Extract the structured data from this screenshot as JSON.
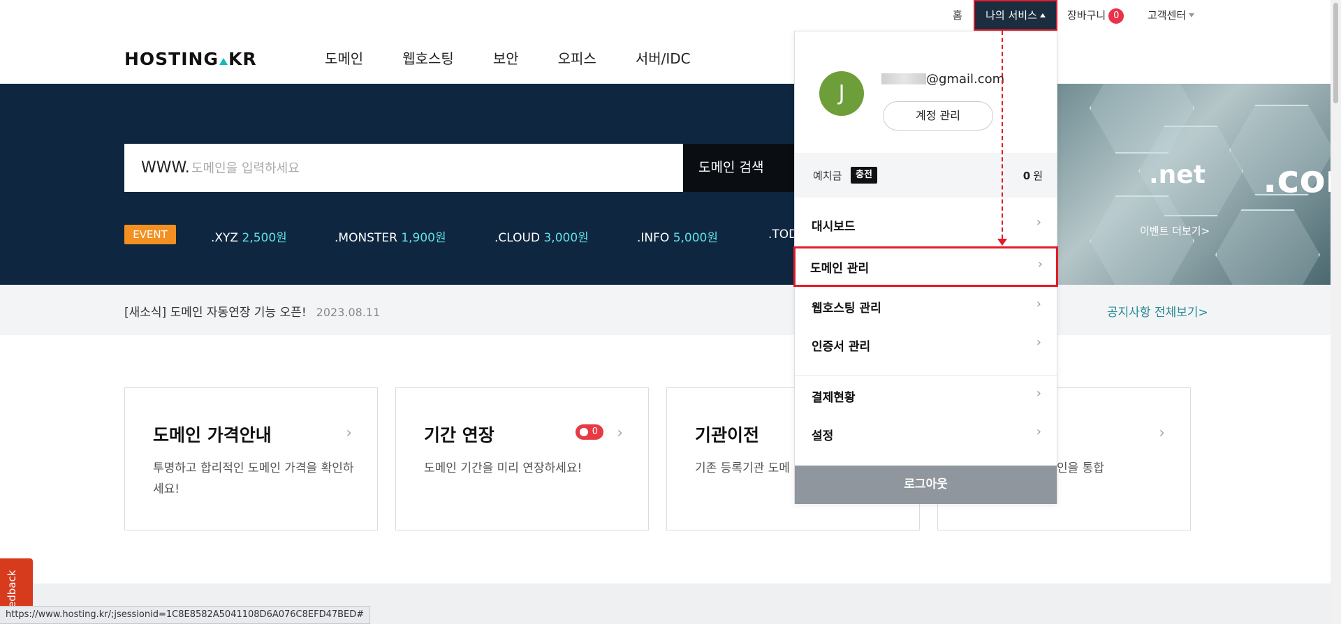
{
  "topbar": {
    "home": "홈",
    "my_service": "나의 서비스",
    "cart": "장바구니",
    "cart_count": "0",
    "customer_center": "고객센터"
  },
  "header": {
    "logo": "HOSTING.KR",
    "logo_left": "HOSTING",
    "logo_right": "KR",
    "nav": [
      "도메인",
      "웹호스팅",
      "보안",
      "오피스",
      "서버/IDC"
    ]
  },
  "hero": {
    "search_prefix": "WWW.",
    "search_placeholder": "도메인을 입력하세요",
    "search_button": "도메인 검색",
    "event_badge": "EVENT",
    "tlds": [
      {
        "name": ".XYZ",
        "price": "2,500원"
      },
      {
        "name": ".MONSTER",
        "price": "1,900원"
      },
      {
        "name": ".CLOUD",
        "price": "3,000원"
      },
      {
        "name": ".INFO",
        "price": "5,000원"
      },
      {
        "name": ".TOD",
        "price": ""
      }
    ],
    "banner_net": ".net",
    "banner_com": ".cor",
    "event_more": "이벤트 더보기>"
  },
  "notice": {
    "text": "[새소식] 도메인 자동연장 기능 오픈!",
    "date": "2023.08.11",
    "more": "공지사항 전체보기>"
  },
  "cards": [
    {
      "title": "도메인 가격안내",
      "desc": "투명하고 합리적인 도메인 가격을 확인하세요!"
    },
    {
      "title": "기간 연장",
      "desc": "도메인 기간을 미리 연장하세요!",
      "badge": "0"
    },
    {
      "title": "기관이전",
      "desc": "기존 등록기관 도메 옮기세요!"
    },
    {
      "title": "",
      "desc": "인을 통합"
    }
  ],
  "dropdown": {
    "avatar_initial": "J",
    "email_suffix": "@gmail.com",
    "account_button": "계정 관리",
    "deposit_label": "예치금",
    "charge_button": "충전",
    "deposit_amount": "0",
    "deposit_unit": "원",
    "menu": [
      "대시보드",
      "도메인 관리",
      "웹호스팅 관리",
      "인증서 관리",
      "결제현황",
      "설정"
    ],
    "logout": "로그아웃"
  },
  "feedback": "Feedback",
  "status_url": "https://www.hosting.kr/;jsessionid=1C8E8582A5041108D6A076C8EFD47BED#",
  "colors": {
    "hero_bg": "#0f2640",
    "highlight": "#e21c2a",
    "event_orange": "#f39021",
    "price_cyan": "#5ee0e8",
    "avatar_green": "#6e9e3a"
  }
}
